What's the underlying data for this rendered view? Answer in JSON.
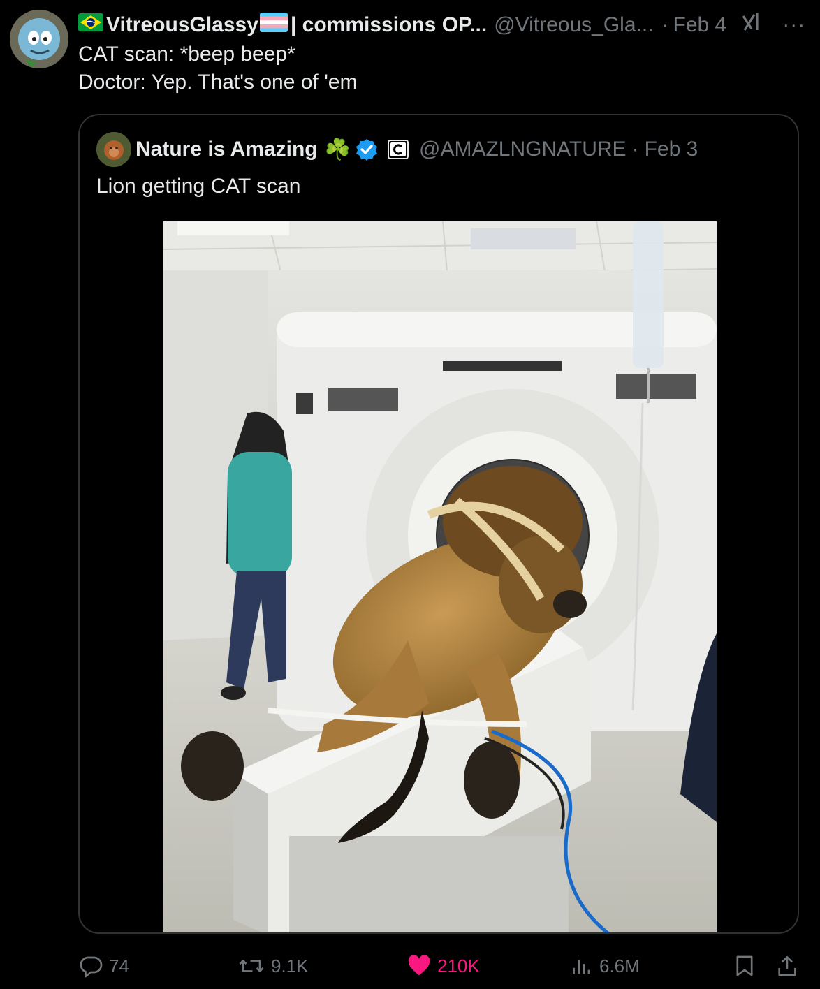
{
  "tweet": {
    "display_name": "VitreousGlassy",
    "display_suffix": "| commissions OP...",
    "handle": "@Vitreous_Gla...",
    "separator": "·",
    "date": "Feb 4",
    "more_label": "···",
    "text_line1": "CAT scan: *beep beep*",
    "text_line2": "Doctor: Yep. That's one of 'em"
  },
  "quote": {
    "display_name": "Nature is Amazing",
    "badge_emoji": "☘️",
    "handle": "@AMAZLNGNATURE",
    "separator": "·",
    "date": "Feb 3",
    "text": "Lion getting CAT scan"
  },
  "actions": {
    "replies": "74",
    "reposts": "9.1K",
    "likes": "210K",
    "views": "6.6M"
  },
  "colors": {
    "background": "#000000",
    "text_primary": "#e7e9ea",
    "text_secondary": "#71767b",
    "like_active": "#f91880",
    "verified": "#1d9bf0",
    "border": "#2f3336"
  }
}
